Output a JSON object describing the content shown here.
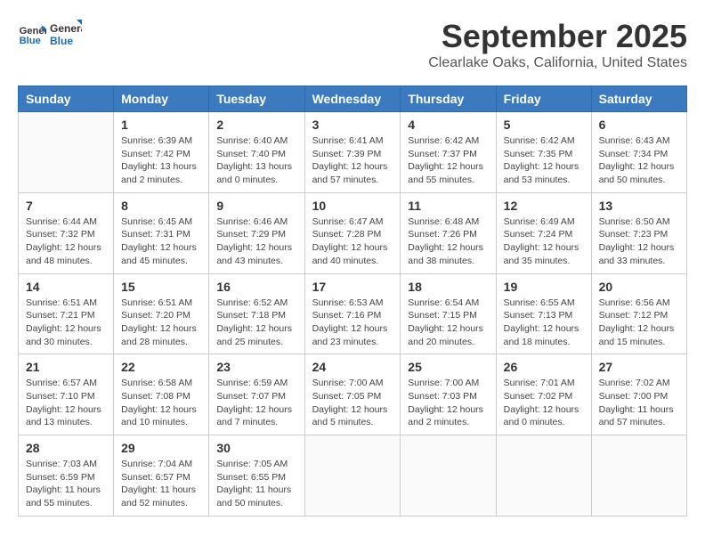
{
  "header": {
    "logo_line1": "General",
    "logo_line2": "Blue",
    "month": "September 2025",
    "location": "Clearlake Oaks, California, United States"
  },
  "weekdays": [
    "Sunday",
    "Monday",
    "Tuesday",
    "Wednesday",
    "Thursday",
    "Friday",
    "Saturday"
  ],
  "weeks": [
    [
      {
        "day": "",
        "info": ""
      },
      {
        "day": "1",
        "info": "Sunrise: 6:39 AM\nSunset: 7:42 PM\nDaylight: 13 hours\nand 2 minutes."
      },
      {
        "day": "2",
        "info": "Sunrise: 6:40 AM\nSunset: 7:40 PM\nDaylight: 13 hours\nand 0 minutes."
      },
      {
        "day": "3",
        "info": "Sunrise: 6:41 AM\nSunset: 7:39 PM\nDaylight: 12 hours\nand 57 minutes."
      },
      {
        "day": "4",
        "info": "Sunrise: 6:42 AM\nSunset: 7:37 PM\nDaylight: 12 hours\nand 55 minutes."
      },
      {
        "day": "5",
        "info": "Sunrise: 6:42 AM\nSunset: 7:35 PM\nDaylight: 12 hours\nand 53 minutes."
      },
      {
        "day": "6",
        "info": "Sunrise: 6:43 AM\nSunset: 7:34 PM\nDaylight: 12 hours\nand 50 minutes."
      }
    ],
    [
      {
        "day": "7",
        "info": "Sunrise: 6:44 AM\nSunset: 7:32 PM\nDaylight: 12 hours\nand 48 minutes."
      },
      {
        "day": "8",
        "info": "Sunrise: 6:45 AM\nSunset: 7:31 PM\nDaylight: 12 hours\nand 45 minutes."
      },
      {
        "day": "9",
        "info": "Sunrise: 6:46 AM\nSunset: 7:29 PM\nDaylight: 12 hours\nand 43 minutes."
      },
      {
        "day": "10",
        "info": "Sunrise: 6:47 AM\nSunset: 7:28 PM\nDaylight: 12 hours\nand 40 minutes."
      },
      {
        "day": "11",
        "info": "Sunrise: 6:48 AM\nSunset: 7:26 PM\nDaylight: 12 hours\nand 38 minutes."
      },
      {
        "day": "12",
        "info": "Sunrise: 6:49 AM\nSunset: 7:24 PM\nDaylight: 12 hours\nand 35 minutes."
      },
      {
        "day": "13",
        "info": "Sunrise: 6:50 AM\nSunset: 7:23 PM\nDaylight: 12 hours\nand 33 minutes."
      }
    ],
    [
      {
        "day": "14",
        "info": "Sunrise: 6:51 AM\nSunset: 7:21 PM\nDaylight: 12 hours\nand 30 minutes."
      },
      {
        "day": "15",
        "info": "Sunrise: 6:51 AM\nSunset: 7:20 PM\nDaylight: 12 hours\nand 28 minutes."
      },
      {
        "day": "16",
        "info": "Sunrise: 6:52 AM\nSunset: 7:18 PM\nDaylight: 12 hours\nand 25 minutes."
      },
      {
        "day": "17",
        "info": "Sunrise: 6:53 AM\nSunset: 7:16 PM\nDaylight: 12 hours\nand 23 minutes."
      },
      {
        "day": "18",
        "info": "Sunrise: 6:54 AM\nSunset: 7:15 PM\nDaylight: 12 hours\nand 20 minutes."
      },
      {
        "day": "19",
        "info": "Sunrise: 6:55 AM\nSunset: 7:13 PM\nDaylight: 12 hours\nand 18 minutes."
      },
      {
        "day": "20",
        "info": "Sunrise: 6:56 AM\nSunset: 7:12 PM\nDaylight: 12 hours\nand 15 minutes."
      }
    ],
    [
      {
        "day": "21",
        "info": "Sunrise: 6:57 AM\nSunset: 7:10 PM\nDaylight: 12 hours\nand 13 minutes."
      },
      {
        "day": "22",
        "info": "Sunrise: 6:58 AM\nSunset: 7:08 PM\nDaylight: 12 hours\nand 10 minutes."
      },
      {
        "day": "23",
        "info": "Sunrise: 6:59 AM\nSunset: 7:07 PM\nDaylight: 12 hours\nand 7 minutes."
      },
      {
        "day": "24",
        "info": "Sunrise: 7:00 AM\nSunset: 7:05 PM\nDaylight: 12 hours\nand 5 minutes."
      },
      {
        "day": "25",
        "info": "Sunrise: 7:00 AM\nSunset: 7:03 PM\nDaylight: 12 hours\nand 2 minutes."
      },
      {
        "day": "26",
        "info": "Sunrise: 7:01 AM\nSunset: 7:02 PM\nDaylight: 12 hours\nand 0 minutes."
      },
      {
        "day": "27",
        "info": "Sunrise: 7:02 AM\nSunset: 7:00 PM\nDaylight: 11 hours\nand 57 minutes."
      }
    ],
    [
      {
        "day": "28",
        "info": "Sunrise: 7:03 AM\nSunset: 6:59 PM\nDaylight: 11 hours\nand 55 minutes."
      },
      {
        "day": "29",
        "info": "Sunrise: 7:04 AM\nSunset: 6:57 PM\nDaylight: 11 hours\nand 52 minutes."
      },
      {
        "day": "30",
        "info": "Sunrise: 7:05 AM\nSunset: 6:55 PM\nDaylight: 11 hours\nand 50 minutes."
      },
      {
        "day": "",
        "info": ""
      },
      {
        "day": "",
        "info": ""
      },
      {
        "day": "",
        "info": ""
      },
      {
        "day": "",
        "info": ""
      }
    ]
  ]
}
